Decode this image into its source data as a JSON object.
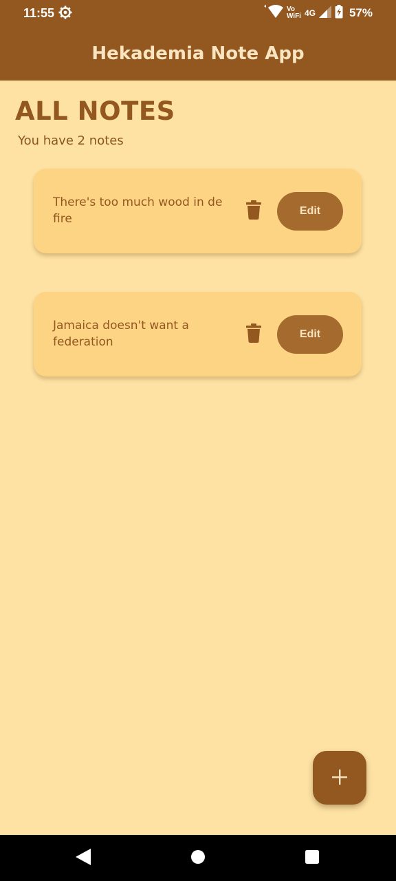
{
  "status_bar": {
    "time": "11:55",
    "network_label_top": "Vo",
    "network_label_bottom": "WiFi",
    "network_type": "4G",
    "battery": "57%"
  },
  "app_bar": {
    "title": "Hekademia Note App"
  },
  "main": {
    "heading": "ALL NOTES",
    "count_text": "You have 2 notes",
    "notes": [
      {
        "text": "There's too much wood in de fire",
        "edit_label": "Edit"
      },
      {
        "text": "Jamaica doesn't want a federation",
        "edit_label": "Edit"
      }
    ]
  },
  "colors": {
    "primary": "#935720",
    "background": "#fde2a4",
    "card": "#fdd484",
    "button": "#a56a2e",
    "on_primary": "#fbe5c0"
  },
  "icons": {
    "settings": "gear-icon",
    "wifi": "wifi-icon",
    "signal": "signal-icon",
    "battery": "battery-charging-icon",
    "delete": "trash-icon",
    "add": "plus-icon",
    "back": "back-icon",
    "home": "home-icon",
    "recents": "recents-icon"
  }
}
